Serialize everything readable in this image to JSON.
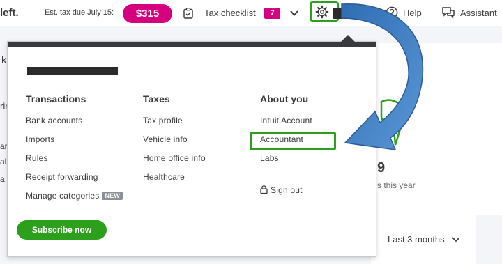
{
  "topbar": {
    "days_left_fragment": "left.",
    "est_tax_label": "Est. tax due July 15:",
    "est_tax_amount": "$315",
    "tax_checklist_label": "Tax checklist",
    "tax_checklist_count": "7",
    "help_label": "Help",
    "assistant_label": "Assistant"
  },
  "background": {
    "fragment_k": "k",
    "fragment_rin": "rir",
    "fragment_ar": "ar",
    "fragment_al": "al",
    "fragment_a": "a",
    "stat_value_fragment": "9",
    "stat_caption_fragment": "s this year",
    "range_select": "Last 3 months"
  },
  "menu": {
    "columns": [
      {
        "heading": "Transactions",
        "items": [
          "Bank accounts",
          "Imports",
          "Rules",
          "Receipt forwarding",
          "Manage categories"
        ]
      },
      {
        "heading": "Taxes",
        "items": [
          "Tax profile",
          "Vehicle info",
          "Home office info",
          "Healthcare"
        ]
      },
      {
        "heading": "About you",
        "items": [
          "Intuit Account",
          "Accountant",
          "Labs"
        ]
      }
    ],
    "new_badge": "NEW",
    "sign_out": "Sign out",
    "subscribe_label": "Subscribe now"
  },
  "colors": {
    "accent_pink": "#d5007f",
    "highlight_green": "#2ca01c",
    "arrow_blue": "#4a7fc1",
    "text_dark": "#393a3d"
  },
  "icons": {
    "clipboard": "clipboard-check-icon",
    "chevron": "chevron-down-icon",
    "gear": "gear-icon",
    "help": "help-circle-icon",
    "assistant": "chat-bubble-icon",
    "lock": "lock-icon"
  }
}
